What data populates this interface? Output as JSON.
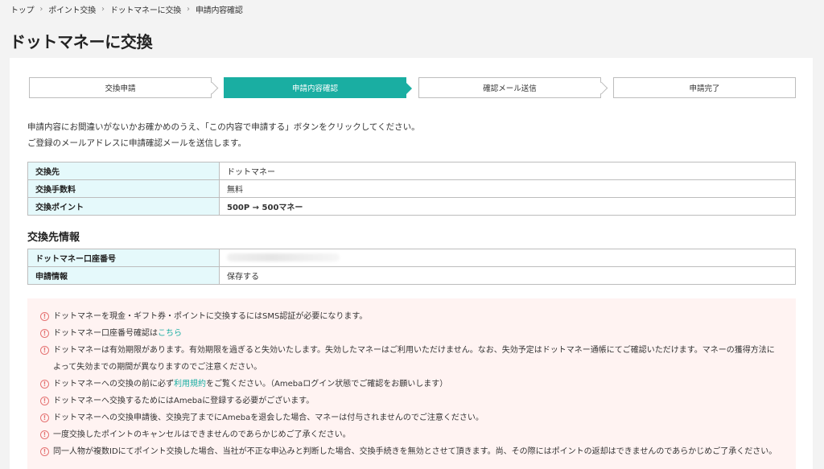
{
  "breadcrumb": [
    "トップ",
    "ポイント交換",
    "ドットマネーに交換",
    "申請内容確認"
  ],
  "page_title": "ドットマネーに交換",
  "steps": [
    "交換申請",
    "申請内容確認",
    "確認メール送信",
    "申請完了"
  ],
  "active_step": 1,
  "intro": [
    "申請内容にお間違いがないかお確かめのうえ、「この内容で申請する」ボタンをクリックしてください。",
    "ご登録のメールアドレスに申請確認メールを送信します。"
  ],
  "exchange": {
    "rows": [
      {
        "label": "交換先",
        "value": "ドットマネー"
      },
      {
        "label": "交換手数料",
        "value": "無料"
      },
      {
        "label": "交換ポイント",
        "value": "500P → 500マネー"
      }
    ]
  },
  "destination": {
    "title": "交換先情報",
    "rows": [
      {
        "label": "ドットマネー口座番号",
        "value": ""
      },
      {
        "label": "申請情報",
        "value": "保存する"
      }
    ]
  },
  "notices": {
    "n1": "ドットマネーを現金・ギフト券・ポイントに交換するにはSMS認証が必要になります。",
    "n2_pre": "ドットマネー口座番号確認は",
    "n2_link": "こちら",
    "n3": "ドットマネーは有効期限があります。有効期限を過ぎると失効いたします。失効したマネーはご利用いただけません。なお、失効予定はドットマネー通帳にてご確認いただけます。マネーの獲得方法によって失効までの期間が異なりますのでご注意ください。",
    "n4_pre": "ドットマネーへの交換の前に必ず",
    "n4_link": "利用規約",
    "n4_post": "をご覧ください。（Amebaログイン状態でご確認をお願いします）",
    "n5": "ドットマネーへ交換するためにはAmebaに登録する必要がございます。",
    "n6": "ドットマネーへの交換申請後、交換完了までにAmebaを退会した場合、マネーは付与されませんのでご注意ください。",
    "n7": "一度交換したポイントのキャンセルはできませんのであらかじめご了承ください。",
    "n8": "同一人物が複数IDにてポイント交換した場合、当社が不正な申込みと判断した場合、交換手続きを無効とさせて頂きます。尚、その際にはポイントの返却はできませんのであらかじめご了承ください。"
  },
  "colors": {
    "accent": "#1aaea2",
    "points": "#e53935",
    "header_cell": "#e5f9fb",
    "notice_bg": "#fff3f2"
  },
  "icons": {
    "notice": "alert-circle-icon",
    "breadcrumb_separator": "chevron-right-icon"
  }
}
